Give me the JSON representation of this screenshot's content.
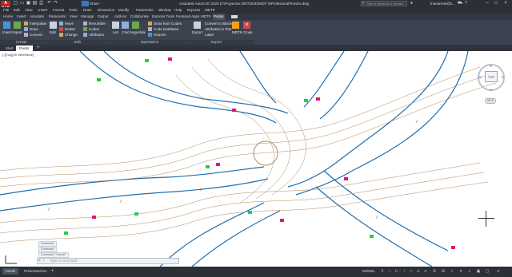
{
  "app": {
    "logo": "A CAD",
    "title": "Autodesk AutoCAD 2023   E:\\Proyectos MDT\\2023\\MDT 9\\Profesional\\Puntos.dwg",
    "share_label": "Share",
    "search_placeholder": "Type a keyword or phrase",
    "user": "fnavarrete@s..."
  },
  "menubar": [
    "File",
    "Edit",
    "View",
    "Insert",
    "Format",
    "Tools",
    "Draw",
    "Dimension",
    "Modify",
    "Parametric",
    "Window",
    "Help",
    "Express",
    "MDT9"
  ],
  "ribbon_tabs": [
    {
      "label": "Home"
    },
    {
      "label": "Insert"
    },
    {
      "label": "Annotate"
    },
    {
      "label": "Parametric"
    },
    {
      "label": "View"
    },
    {
      "label": "Manage"
    },
    {
      "label": "Output"
    },
    {
      "label": "Add-ins"
    },
    {
      "label": "Collaborate"
    },
    {
      "label": "Express Tools"
    },
    {
      "label": "Featured Apps"
    },
    {
      "label": "MDT9"
    },
    {
      "label": "Points",
      "active": true
    }
  ],
  "ribbon": {
    "create": {
      "insert": "Insert",
      "import": "Import",
      "interpolate": "Interpolate",
      "draw": "Draw",
      "convert": "Convert",
      "panel": "Create"
    },
    "edit": {
      "edit": "Edit",
      "move": "Move",
      "delete": "Delete",
      "change": "Change",
      "renumber": "Renumber",
      "codes": "Codes",
      "attributes": "Attributes",
      "panel": "Edit"
    },
    "operations": {
      "list": "List",
      "find": "Find",
      "hyperlink": "Hyperlink",
      "draw_codes": "Draw from Codes",
      "code_db": "Code Database",
      "reports": "Reports",
      "panel": "Operations"
    },
    "export": {
      "export": "Export",
      "convert_blocks": "Convert to Blocks",
      "attr_text": "Attributes to Text",
      "label": "Label",
      "mdt9": "MDT9",
      "close": "Close",
      "panel": "Export"
    }
  },
  "doc_tabs": [
    {
      "label": "Start"
    },
    {
      "label": "Points",
      "active": true
    }
  ],
  "viewport_label": "[-][Top][2D Wireframe]",
  "viewcube": {
    "top": "TOP",
    "n": "N",
    "s": "S",
    "e": "E",
    "w": "W",
    "wcs": "WCS"
  },
  "command": {
    "placeholder": "Type a command",
    "history": [
      "Command:",
      "Command:",
      "Command:  *Cancel*"
    ]
  },
  "status": {
    "model": "Model",
    "layout": "Presentación1",
    "mode": "MODEL"
  },
  "colors": {
    "ribbon": "#3c4250",
    "chrome": "#2b2f36",
    "contour": "#b38b5c",
    "road": "#1f6fb0",
    "point_green": "#1fd14a",
    "point_magenta": "#e0147a"
  }
}
